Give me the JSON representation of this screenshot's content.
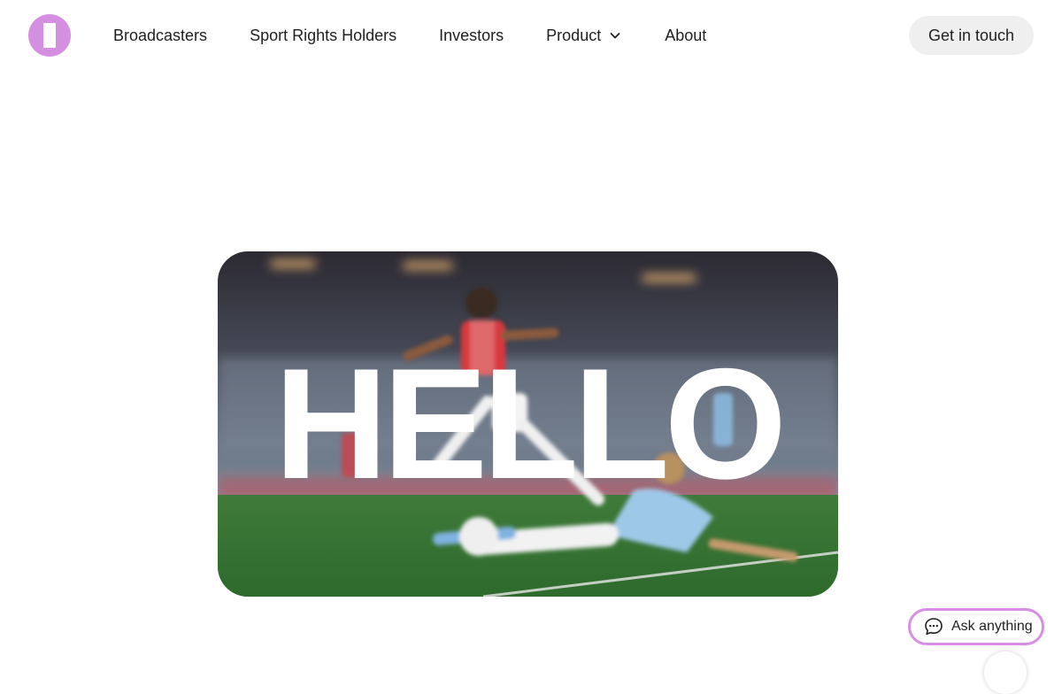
{
  "header": {
    "nav": [
      {
        "label": "Broadcasters"
      },
      {
        "label": "Sport Rights Holders"
      },
      {
        "label": "Investors"
      },
      {
        "label": "Product"
      },
      {
        "label": "About"
      }
    ],
    "cta_label": "Get in touch"
  },
  "hero": {
    "overlay_text": "HELLO"
  },
  "chat": {
    "label": "Ask anything"
  },
  "colors": {
    "brand": "#d58fe0",
    "chat_border": "#d98ee6",
    "cta_bg": "#efefef"
  },
  "icons": [
    "logo-icon",
    "chevron-down-icon",
    "chat-bubble-icon"
  ]
}
